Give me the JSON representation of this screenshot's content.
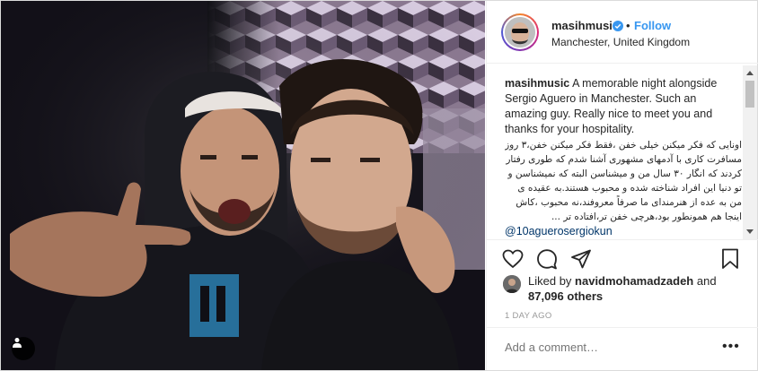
{
  "post": {
    "username": "masihmusic",
    "verified": true,
    "separator": "•",
    "follow_label": "Follow",
    "location": "Manchester, United Kingdom"
  },
  "caption": {
    "username": "masihmusic",
    "text_en": "A memorable night alongside Sergio Aguero in Manchester. Such an amazing guy. Really nice to meet you and thanks for your hospitality.",
    "text_fa": "اونایی که فکر میکنن خیلی خفن ،فقط فکر میکنن خفن،۳ روز مسافرت کاری با آدمهای مشهوری آشنا شدم که طوری رفتار کردند که انگار ۳۰ سال من و میشناسن البته که نمیشناسن و تو دنیا این افراد شناخته شده و محبوب هستند.به عقیده ی من به عده از هنرمندای ما صرفاً معروفند،نه محبوب ،کاش اینجا هم همونطور بود،هرچی خفن تر،افتاده تر ...",
    "mention": "@10aguerosergiokun"
  },
  "icons": {
    "like": "heart-icon",
    "comment": "speech-bubble-icon",
    "share": "paper-plane-icon",
    "save": "bookmark-icon",
    "tag": "person-tag-icon",
    "verified": "verified-badge-icon",
    "more": "more-options-icon"
  },
  "likes": {
    "prefix": "Liked by",
    "first_liker": "navidmohamadzadeh",
    "connector": "and",
    "others_count": "87,096 others"
  },
  "timestamp": "1 DAY AGO",
  "comment_box": {
    "placeholder": "Add a comment…",
    "more_label": "•••"
  },
  "colors": {
    "accent": "#3897f0",
    "text": "#262626",
    "muted": "#999999",
    "border": "#efefef"
  }
}
